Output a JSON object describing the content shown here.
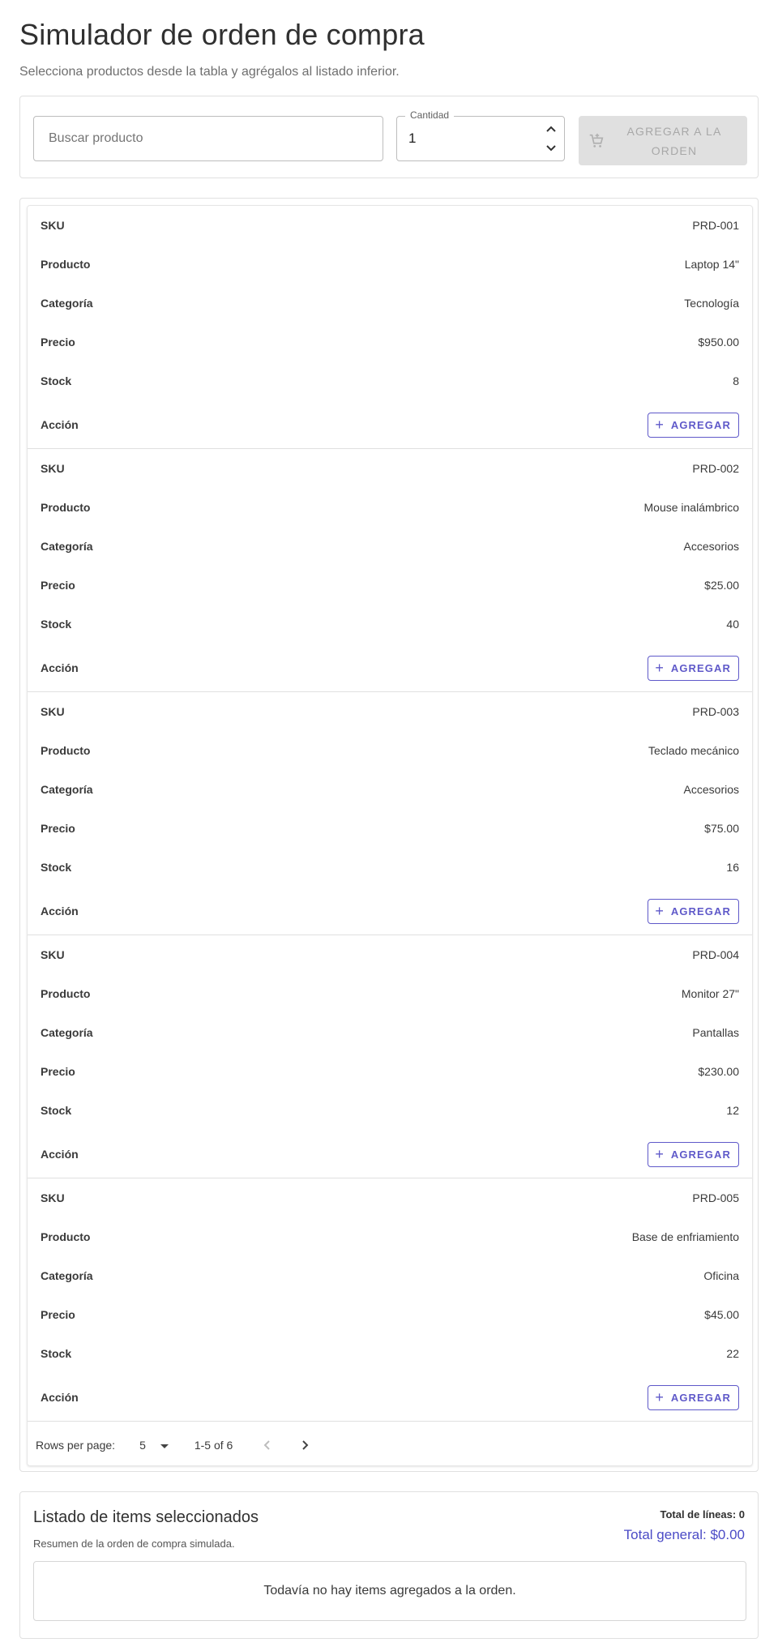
{
  "header": {
    "title": "Simulador de orden de compra",
    "subtitle": "Selecciona productos desde la tabla y agrégalos al listado inferior."
  },
  "toolbar": {
    "search_placeholder": "Buscar producto",
    "quantity_label": "Cantidad",
    "quantity_value": "1",
    "add_to_order_label": "AGREGAR A LA ORDEN",
    "add_to_order_disabled": true
  },
  "table": {
    "labels": {
      "sku": "SKU",
      "producto": "Producto",
      "categoria": "Categoría",
      "precio": "Precio",
      "stock": "Stock",
      "accion": "Acción"
    },
    "add_label": "AGREGAR",
    "products": [
      {
        "sku": "PRD-001",
        "producto": "Laptop 14\"",
        "categoria": "Tecnología",
        "precio": "$950.00",
        "stock": "8"
      },
      {
        "sku": "PRD-002",
        "producto": "Mouse inalámbrico",
        "categoria": "Accesorios",
        "precio": "$25.00",
        "stock": "40"
      },
      {
        "sku": "PRD-003",
        "producto": "Teclado mecánico",
        "categoria": "Accesorios",
        "precio": "$75.00",
        "stock": "16"
      },
      {
        "sku": "PRD-004",
        "producto": "Monitor 27\"",
        "categoria": "Pantallas",
        "precio": "$230.00",
        "stock": "12"
      },
      {
        "sku": "PRD-005",
        "producto": "Base de enfriamiento",
        "categoria": "Oficina",
        "precio": "$45.00",
        "stock": "22"
      }
    ],
    "pagination": {
      "rows_per_page_label": "Rows per page:",
      "rows_per_page_value": "5",
      "range": "1-5 of 6"
    }
  },
  "summary": {
    "title": "Listado de items seleccionados",
    "subtitle": "Resumen de la orden de compra simulada.",
    "total_lines": "Total de líneas: 0",
    "total_general": "Total general: $0.00",
    "empty_message": "Todavía no hay items agregados a la orden."
  },
  "colors": {
    "accent": "#5f59c9",
    "total_accent": "#4b4bc6",
    "disabled_bg": "#e0e0e0",
    "disabled_text": "#a8a8a8",
    "border": "#e0e0e0"
  },
  "icons": {
    "quantity_up": "chevron-up-icon",
    "quantity_down": "chevron-down-icon",
    "add_to_order": "add-shopping-cart-icon",
    "add_row": "plus-icon",
    "rows_select": "caret-down-icon",
    "prev_page": "chevron-left-icon",
    "next_page": "chevron-right-icon"
  }
}
